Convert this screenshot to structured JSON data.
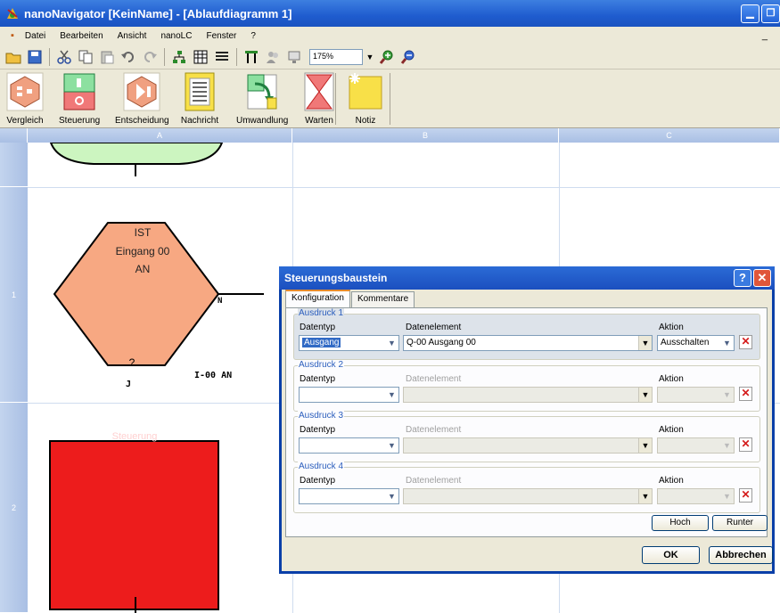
{
  "window": {
    "title": "nanoNavigator [KeinName] - [Ablaufdiagramm 1]"
  },
  "menu": [
    "Datei",
    "Bearbeiten",
    "Ansicht",
    "nanoLC",
    "Fenster",
    "?"
  ],
  "toolbar": {
    "zoom": "175%"
  },
  "palette": [
    "Vergleich",
    "Steuerung",
    "Entscheidung",
    "Nachricht",
    "Umwandlung",
    "Warten",
    "Notiz"
  ],
  "grid": {
    "columns": [
      "A",
      "B",
      "C"
    ],
    "rows": [
      "1",
      "2"
    ]
  },
  "canvas": {
    "hex_line1": "IST",
    "hex_line2": "Eingang 00",
    "hex_line3": "AN",
    "hex_bottom": "?",
    "hex_n": "N",
    "hex_j": "J",
    "side_label": "I-00 AN",
    "red_label": "Steuerung"
  },
  "dialog": {
    "title": "Steuerungsbaustein",
    "tabs": [
      "Konfiguration",
      "Kommentare"
    ],
    "col_datentyp": "Datentyp",
    "col_datenelement": "Datenelement",
    "col_aktion": "Aktion",
    "groups": [
      {
        "label": "Ausdruck 1",
        "datentyp": "Ausgang",
        "datenelement": "Q-00  Ausgang 00",
        "aktion": "Ausschalten"
      },
      {
        "label": "Ausdruck 2",
        "datentyp": "",
        "datenelement": "",
        "aktion": ""
      },
      {
        "label": "Ausdruck 3",
        "datentyp": "",
        "datenelement": "",
        "aktion": ""
      },
      {
        "label": "Ausdruck 4",
        "datentyp": "",
        "datenelement": "",
        "aktion": ""
      }
    ],
    "hoch": "Hoch",
    "runter": "Runter",
    "ok": "OK",
    "abbrechen": "Abbrechen"
  }
}
